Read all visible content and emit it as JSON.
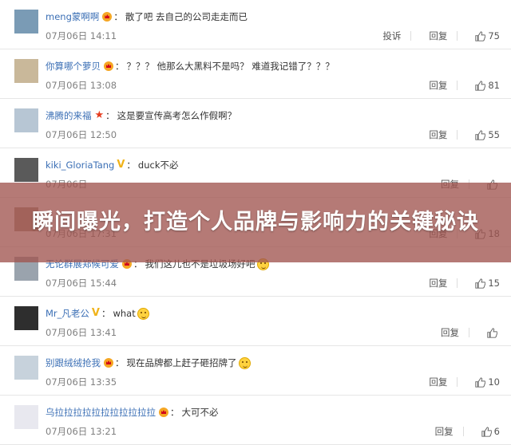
{
  "banner": {
    "title": "瞬间曝光，打造个人品牌与影响力的关键秘诀"
  },
  "actions": {
    "report_label": "投诉",
    "reply_label": "回复"
  },
  "comments": [
    {
      "username": "meng蒙啊啊",
      "badge": "crown",
      "text": "散了吧 去自己的公司走走而已",
      "emoji": false,
      "time": "07月06日 14:11",
      "likes": "75",
      "report": true
    },
    {
      "username": "你算哪个萝贝",
      "badge": "crown",
      "text": "？？？ 他那么大黑料不是吗？ 难道我记错了？？？",
      "emoji": false,
      "time": "07月06日 13:08",
      "likes": "81",
      "report": false
    },
    {
      "username": "沸腾的来福",
      "badge": "star",
      "text": "这是要宣传高考怎么作假啊？",
      "emoji": false,
      "time": "07月06日 12:50",
      "likes": "55",
      "report": false
    },
    {
      "username": "kiki_GloriaTang",
      "badge": "v",
      "text": "duck不必",
      "emoji": false,
      "time": "07月06日 ",
      "likes": "",
      "report": false
    },
    {
      "username": "",
      "badge": "",
      "text": "",
      "emoji": false,
      "time": "07月06日 17:31",
      "likes": "18",
      "report": false
    },
    {
      "username": "无论群展郑候可爱",
      "badge": "crown",
      "text": "我们这儿也不是垃圾场好吧",
      "emoji": true,
      "time": "07月06日 15:44",
      "likes": "15",
      "report": false
    },
    {
      "username": "Mr_凡老公",
      "badge": "v",
      "text": "what",
      "emoji": true,
      "time": "07月06日 13:41",
      "likes": "",
      "report": false
    },
    {
      "username": "别跟绒绒抢我",
      "badge": "crown",
      "text": "现在品牌都上赶子砸招牌了",
      "emoji": true,
      "time": "07月06日 13:35",
      "likes": "10",
      "report": false
    },
    {
      "username": "乌拉拉拉拉拉拉拉拉拉拉拉",
      "badge": "crown",
      "text": "大可不必",
      "emoji": false,
      "time": "07月06日 13:21",
      "likes": "6",
      "report": false
    }
  ],
  "icons": {
    "like": "thumbs-up-icon",
    "vip": "crown-icon",
    "verified": "v-icon"
  },
  "colors": {
    "username": "#3b6fb5",
    "banner": "#a05550",
    "badge": "#f5a623"
  }
}
